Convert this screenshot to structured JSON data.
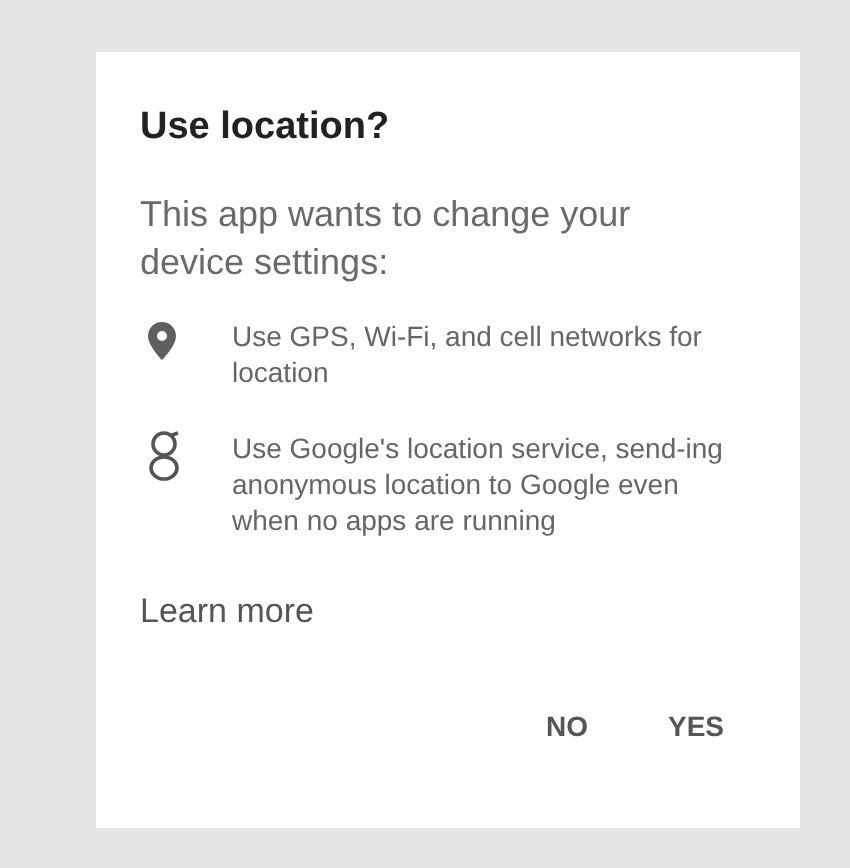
{
  "dialog": {
    "title": "Use location?",
    "message": "This app wants to change your device settings:",
    "items": [
      {
        "kind": "pin",
        "text": "Use GPS, Wi-Fi, and cell networks for location"
      },
      {
        "kind": "g",
        "text": "Use Google's location service, send-ing anonymous location to Google even when no apps are running"
      }
    ],
    "link": "Learn more",
    "buttons": [
      "NO",
      "YES"
    ]
  }
}
